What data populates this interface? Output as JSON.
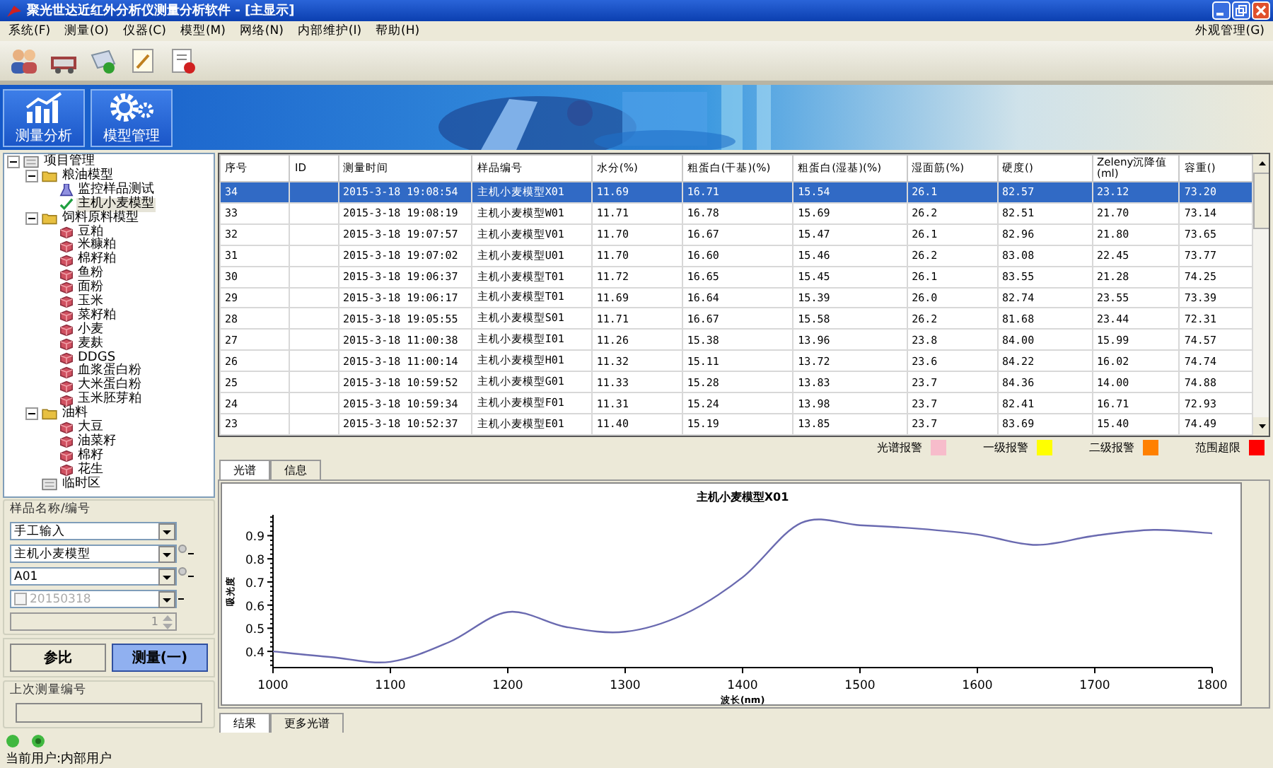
{
  "window": {
    "title": "聚光世达近红外分析仪测量分析软件 - [主显示]"
  },
  "menu": {
    "items": [
      "系统(F)",
      "测量(O)",
      "仪器(C)",
      "模型(M)",
      "网络(N)",
      "内部维护(I)",
      "帮助(H)"
    ],
    "right": "外观管理(G)"
  },
  "banner": {
    "buttons": [
      {
        "label": "测量分析",
        "kind": "chart"
      },
      {
        "label": "模型管理",
        "kind": "gears"
      }
    ]
  },
  "tree": [
    {
      "label": "项目管理",
      "kind": "root",
      "expanded": true,
      "children": [
        {
          "label": "粮油模型",
          "kind": "folder",
          "expanded": true,
          "children": [
            {
              "label": "监控样品测试",
              "kind": "flask"
            },
            {
              "label": "主机小麦模型",
              "kind": "check",
              "selected": true
            }
          ]
        },
        {
          "label": "饲料原料模型",
          "kind": "folder",
          "expanded": true,
          "children": [
            {
              "label": "豆粕",
              "kind": "cube"
            },
            {
              "label": "米糠粕",
              "kind": "cube"
            },
            {
              "label": "棉籽粕",
              "kind": "cube"
            },
            {
              "label": "鱼粉",
              "kind": "cube"
            },
            {
              "label": "面粉",
              "kind": "cube"
            },
            {
              "label": "玉米",
              "kind": "cube"
            },
            {
              "label": "菜籽粕",
              "kind": "cube"
            },
            {
              "label": "小麦",
              "kind": "cube"
            },
            {
              "label": "麦麸",
              "kind": "cube"
            },
            {
              "label": "DDGS",
              "kind": "cube"
            },
            {
              "label": "血浆蛋白粉",
              "kind": "cube"
            },
            {
              "label": "大米蛋白粉",
              "kind": "cube"
            },
            {
              "label": "玉米胚芽粕",
              "kind": "cube"
            }
          ]
        },
        {
          "label": "油料",
          "kind": "folder",
          "expanded": true,
          "children": [
            {
              "label": "大豆",
              "kind": "cube"
            },
            {
              "label": "油菜籽",
              "kind": "cube"
            },
            {
              "label": "棉籽",
              "kind": "cube"
            },
            {
              "label": "花生",
              "kind": "cube"
            }
          ]
        },
        {
          "label": "临时区",
          "kind": "root"
        }
      ]
    }
  ],
  "sample_form": {
    "title": "样品名称/编号",
    "input_mode": "手工输入",
    "model": "主机小麦模型",
    "code": "A01",
    "date": {
      "value": "20150318",
      "checked": false,
      "disabled": true
    },
    "counter": "1"
  },
  "buttons": [
    {
      "label": "参比",
      "selected": false
    },
    {
      "label": "测量(一)",
      "selected": true
    }
  ],
  "last_measurement": {
    "title": "上次测量编号"
  },
  "table": {
    "columns": [
      "序号",
      "ID",
      "测量时间",
      "样品编号",
      "水分(%)",
      "粗蛋白(干基)(%)",
      "粗蛋白(湿基)(%)",
      "湿面筋(%)",
      "硬度()",
      "Zeleny沉降值(ml)",
      "容重()"
    ],
    "rows": [
      {
        "selected": true,
        "cells": [
          "34",
          "",
          "2015-3-18 19:08:54",
          "主机小麦模型X01",
          "11.69",
          "16.71",
          "15.54",
          "26.1",
          "82.57",
          "23.12",
          "73.20"
        ]
      },
      {
        "selected": false,
        "cells": [
          "33",
          "",
          "2015-3-18 19:08:19",
          "主机小麦模型W01",
          "11.71",
          "16.78",
          "15.69",
          "26.2",
          "82.51",
          "21.70",
          "73.14"
        ]
      },
      {
        "selected": false,
        "cells": [
          "32",
          "",
          "2015-3-18 19:07:57",
          "主机小麦模型V01",
          "11.70",
          "16.67",
          "15.47",
          "26.1",
          "82.96",
          "21.80",
          "73.65"
        ]
      },
      {
        "selected": false,
        "cells": [
          "31",
          "",
          "2015-3-18 19:07:02",
          "主机小麦模型U01",
          "11.70",
          "16.60",
          "15.46",
          "26.2",
          "83.08",
          "22.45",
          "73.77"
        ]
      },
      {
        "selected": false,
        "cells": [
          "30",
          "",
          "2015-3-18 19:06:37",
          "主机小麦模型T01",
          "11.72",
          "16.65",
          "15.45",
          "26.1",
          "83.55",
          "21.28",
          "74.25"
        ]
      },
      {
        "selected": false,
        "cells": [
          "29",
          "",
          "2015-3-18 19:06:17",
          "主机小麦模型T01",
          "11.69",
          "16.64",
          "15.39",
          "26.0",
          "82.74",
          "23.55",
          "73.39"
        ]
      },
      {
        "selected": false,
        "cells": [
          "28",
          "",
          "2015-3-18 19:05:55",
          "主机小麦模型S01",
          "11.71",
          "16.67",
          "15.58",
          "26.2",
          "81.68",
          "23.44",
          "72.31"
        ]
      },
      {
        "selected": false,
        "cells": [
          "27",
          "",
          "2015-3-18 11:00:38",
          "主机小麦模型I01",
          "11.26",
          "15.38",
          "13.96",
          "23.8",
          "84.00",
          "15.99",
          "74.57"
        ]
      },
      {
        "selected": false,
        "cells": [
          "26",
          "",
          "2015-3-18 11:00:14",
          "主机小麦模型H01",
          "11.32",
          "15.11",
          "13.72",
          "23.6",
          "84.22",
          "16.02",
          "74.74"
        ]
      },
      {
        "selected": false,
        "cells": [
          "25",
          "",
          "2015-3-18 10:59:52",
          "主机小麦模型G01",
          "11.33",
          "15.28",
          "13.83",
          "23.7",
          "84.36",
          "14.00",
          "74.88"
        ]
      },
      {
        "selected": false,
        "cells": [
          "24",
          "",
          "2015-3-18 10:59:34",
          "主机小麦模型F01",
          "11.31",
          "15.24",
          "13.98",
          "23.7",
          "82.41",
          "16.71",
          "72.93"
        ]
      },
      {
        "selected": false,
        "cells": [
          "23",
          "",
          "2015-3-18 10:52:37",
          "主机小麦模型E01",
          "11.40",
          "15.19",
          "13.85",
          "23.7",
          "83.69",
          "15.40",
          "74.49"
        ]
      }
    ]
  },
  "legend": [
    {
      "label": "光谱报警",
      "color": "#f7bccb"
    },
    {
      "label": "一级报警",
      "color": "#ffff00"
    },
    {
      "label": "二级报警",
      "color": "#ff8000"
    },
    {
      "label": "范围超限",
      "color": "#ff0000"
    }
  ],
  "tabs": [
    {
      "label": "光谱",
      "selected": true
    },
    {
      "label": "信息",
      "selected": false
    }
  ],
  "spectrum": {
    "chart_data": {
      "type": "line",
      "title": "主机小麦模型X01",
      "xlabel": "波长(nm)",
      "ylabel": "吸光度",
      "x": [
        1000,
        1050,
        1100,
        1150,
        1200,
        1250,
        1300,
        1350,
        1400,
        1450,
        1500,
        1550,
        1600,
        1650,
        1700,
        1750,
        1800
      ],
      "series": [
        {
          "color": "#6a6ab0",
          "values": [
            0.4,
            0.375,
            0.355,
            0.44,
            0.57,
            0.505,
            0.485,
            0.56,
            0.72,
            0.955,
            0.945,
            0.93,
            0.905,
            0.86,
            0.9,
            0.925,
            0.91
          ]
        }
      ],
      "xlim": [
        1000,
        1800
      ],
      "ylim": [
        0.33,
        0.99
      ],
      "xticks": [
        1000,
        1100,
        1200,
        1300,
        1400,
        1500,
        1600,
        1700,
        1800
      ],
      "yticks": [
        0.4,
        0.5,
        0.6,
        0.7,
        0.8,
        0.9
      ]
    }
  },
  "bottom_tabs": [
    {
      "label": "结果",
      "selected": true
    },
    {
      "label": "更多光谱",
      "selected": false
    }
  ],
  "status_bar": {
    "text": "当前用户:内部用户"
  }
}
